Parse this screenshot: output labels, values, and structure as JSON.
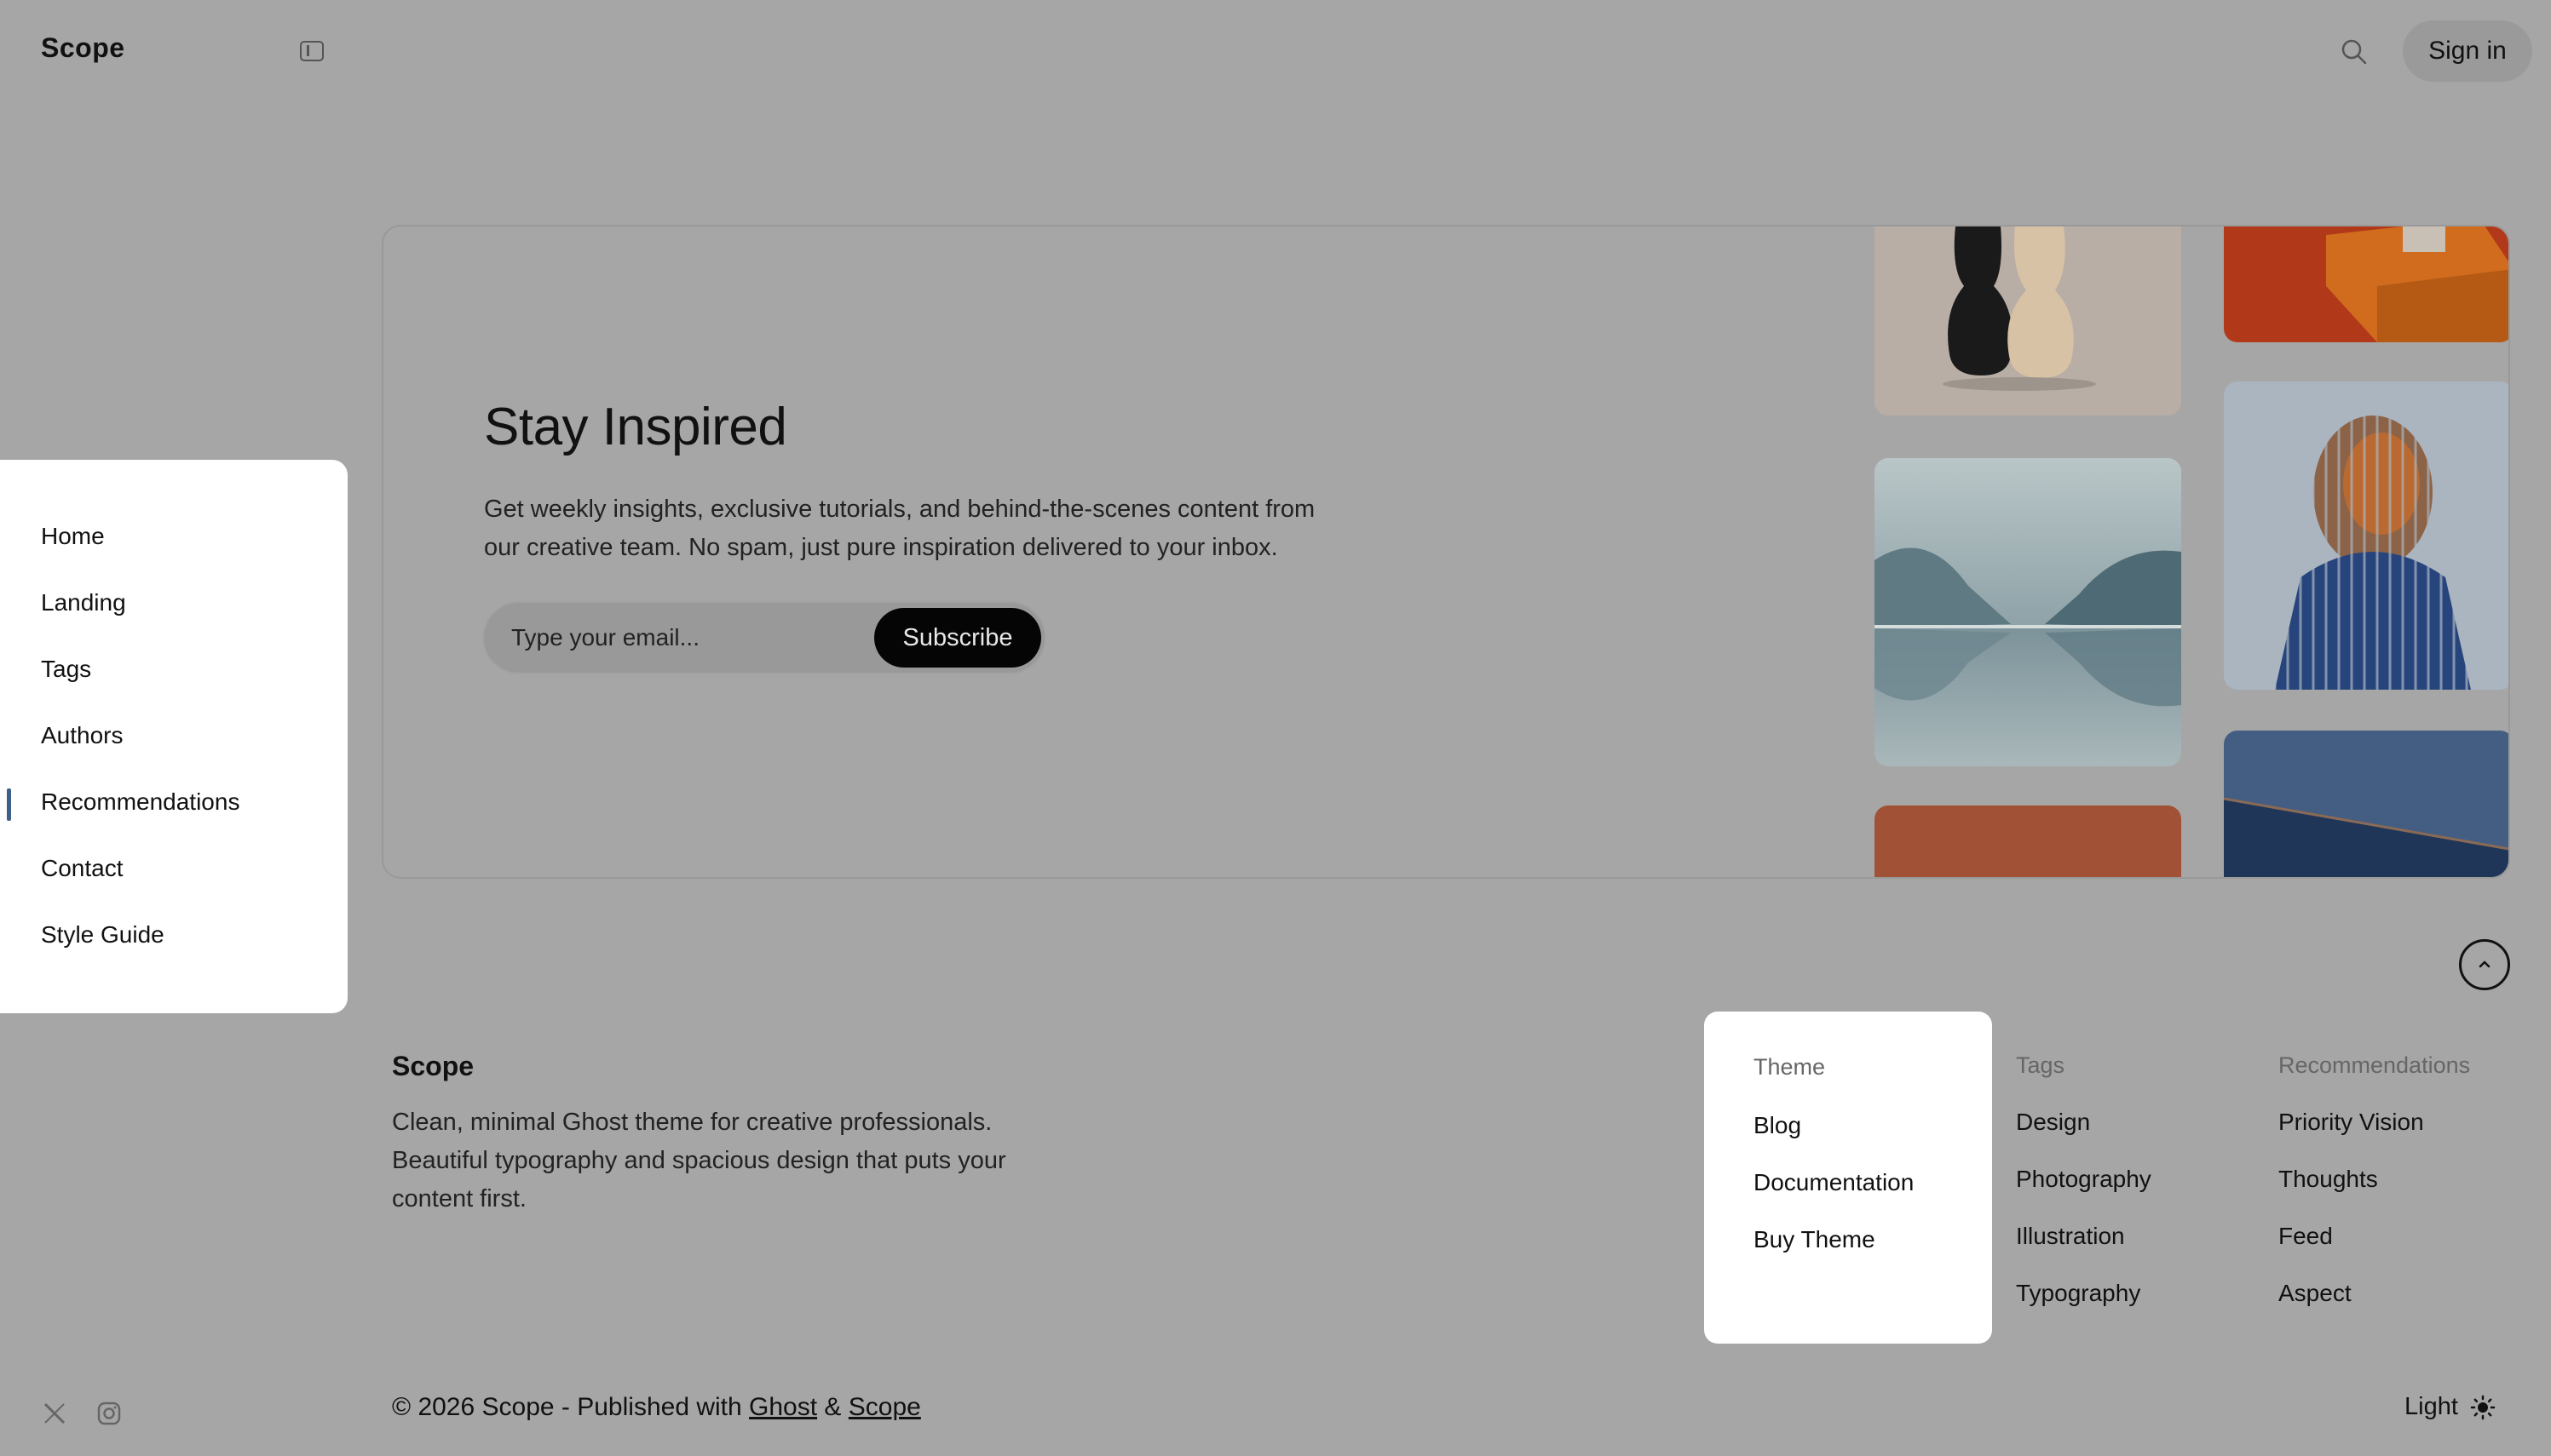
{
  "header": {
    "brand": "Scope",
    "signin_label": "Sign in"
  },
  "nav": {
    "items": [
      {
        "label": "Home"
      },
      {
        "label": "Landing"
      },
      {
        "label": "Tags"
      },
      {
        "label": "Authors"
      },
      {
        "label": "Recommendations",
        "active": true
      },
      {
        "label": "Contact"
      },
      {
        "label": "Style Guide"
      }
    ]
  },
  "hero": {
    "title": "Stay Inspired",
    "description_line1": "Get weekly insights, exclusive tutorials, and behind-the-scenes content from",
    "description_line2": "our creative team. No spam, just pure inspiration delivered to your inbox.",
    "email_placeholder": "Type your email...",
    "subscribe_label": "Subscribe"
  },
  "footer": {
    "brand": "Scope",
    "desc_line1": "Clean, minimal Ghost theme for creative professionals.",
    "desc_line2": "Beautiful typography and spacious design that puts your",
    "desc_line3": "content first.",
    "columns": [
      {
        "heading": "Theme",
        "links": [
          "Blog",
          "Documentation",
          "Buy Theme"
        ]
      },
      {
        "heading": "Tags",
        "links": [
          "Design",
          "Photography",
          "Illustration",
          "Typography"
        ]
      },
      {
        "heading": "Recommendations",
        "links": [
          "Priority Vision",
          "Thoughts",
          "Feed",
          "Aspect"
        ]
      }
    ],
    "copyright_prefix": "© 2026 Scope - Published with",
    "ghost_link": "Ghost",
    "amp": "&",
    "scope_link": "Scope",
    "mode_label": "Light"
  },
  "icons": {
    "sidebar_toggle": "sidebar-toggle-icon",
    "search": "search-icon",
    "back_to_top": "chevron-up-icon",
    "x": "x-logo-icon",
    "instagram": "instagram-icon",
    "sun": "sun-icon"
  },
  "colors": {
    "page_bg": "#a6a6a6",
    "accent_bar": "#3d5f8a",
    "subscribe_bg": "#050505"
  }
}
